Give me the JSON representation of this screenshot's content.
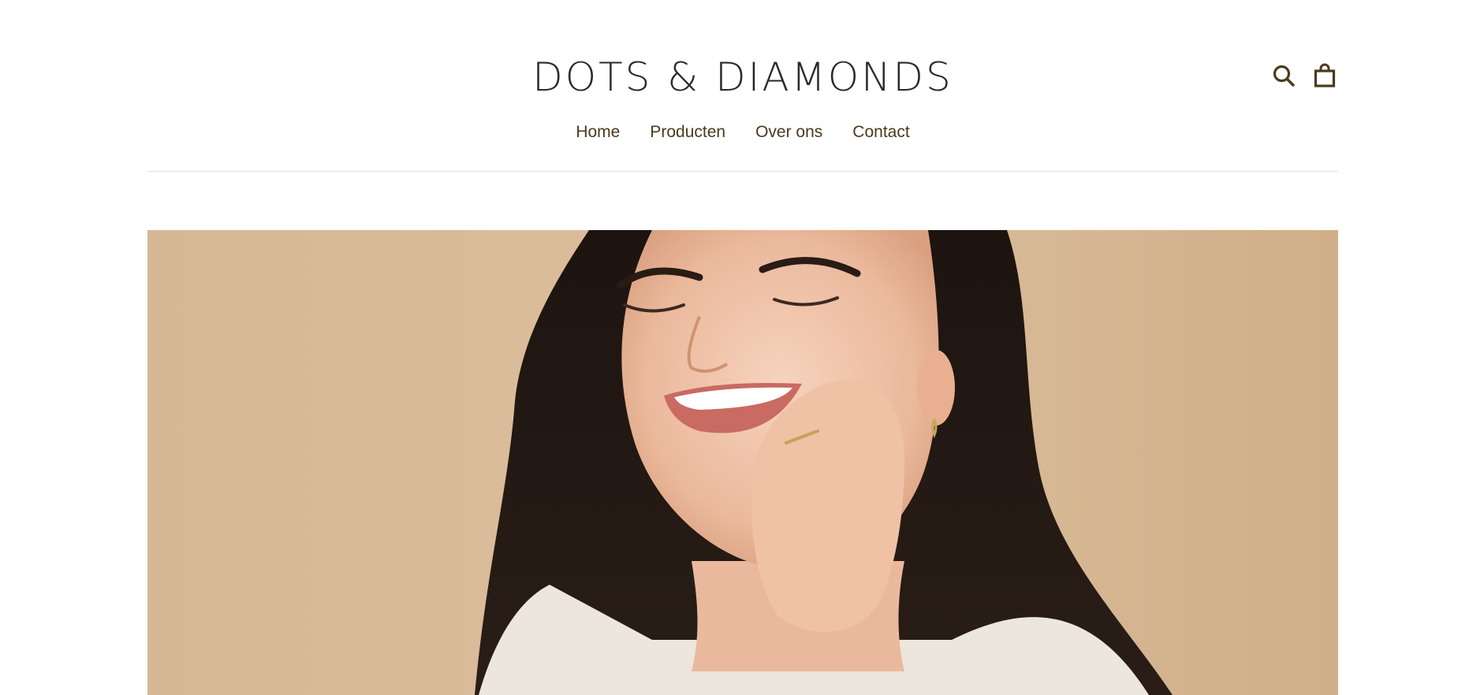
{
  "header": {
    "logo_text": "DOTS & DIAMONDS",
    "nav": [
      {
        "label": "Home"
      },
      {
        "label": "Producten"
      },
      {
        "label": "Over ons"
      },
      {
        "label": "Contact"
      }
    ],
    "icons": [
      "search-icon",
      "shopping-bag-icon"
    ]
  },
  "hero": {
    "background_color": "#d9ba97",
    "image_subject": "portrait-photo"
  },
  "colors": {
    "brand_text": "#2c2a26",
    "accent": "#4a3a1c"
  }
}
